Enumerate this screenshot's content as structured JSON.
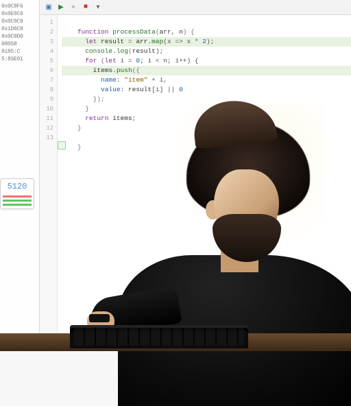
{
  "toolbar": {
    "icons": [
      "save",
      "run",
      "bug",
      "stop",
      "down"
    ]
  },
  "sidebar": {
    "snips": [
      "0x0C8F6",
      "0x0E0C6",
      "0x0C0C9",
      "0x1D6C8",
      "0x0C0D0",
      "08058",
      "0i85:C",
      "5:8SE01"
    ]
  },
  "panel": {
    "value": "5120"
  },
  "gutter": {
    "lines": [
      "1",
      "2",
      "3",
      "4",
      "5",
      "6",
      "7",
      "8",
      "9",
      "10",
      "11",
      "12",
      "13"
    ]
  },
  "code": {
    "l1_a": "function",
    "l1_b": " processData",
    "l1_c": "(",
    "l1_d": "arr",
    "l1_e": ", ",
    "l1_f": "n",
    "l1_g": ") {",
    "l2_a": "  let ",
    "l2_b": "result",
    "l2_c": " = ",
    "l2_d": "arr",
    "l2_e": ".",
    "l2_f": "map",
    "l2_g": "(x => x * ",
    "l2_h": "2",
    "l2_i": ");",
    "l3_a": "  ",
    "l3_b": "console",
    "l3_c": ".",
    "l3_d": "log",
    "l3_e": "(",
    "l3_f": "result",
    "l3_g": ");",
    "l4_a": "  ",
    "l4_b": "for",
    "l4_c": " (",
    "l4_d": "let",
    "l4_e": " i = ",
    "l4_f": "0",
    "l4_g": "; i < n; i++) {",
    "l5_a": "    ",
    "l5_b": "items",
    "l5_c": ".",
    "l5_d": "push",
    "l5_e": "(",
    "l5_f": "{",
    "l6_a": "      ",
    "l6_b": "name",
    "l6_c": ": ",
    "l6_d": "\"item\"",
    "l6_e": " + i,",
    "l7_a": "      ",
    "l7_b": "value",
    "l7_c": ": ",
    "l7_d": "result",
    "l7_e": "[i] || ",
    "l7_f": "0",
    "l8_a": "    ",
    "l8_b": "});",
    "l9_a": "  ",
    "l9_b": "}",
    "l10_a": "  ",
    "l10_b": "return",
    "l10_c": " ",
    "l10_d": "items",
    "l10_e": ";",
    "l11_a": "}",
    "l12_a": "",
    "l13_a": "}"
  }
}
